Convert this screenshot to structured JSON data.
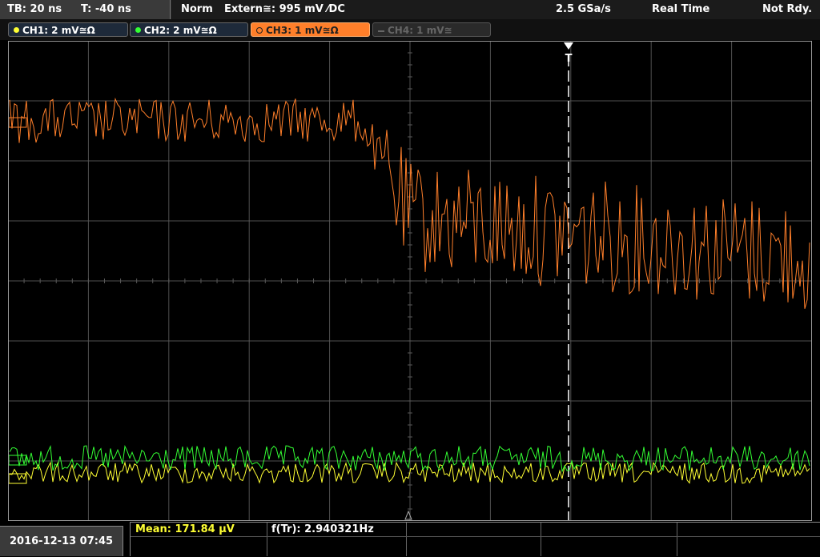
{
  "header": {
    "timebase": "TB: 20 ns",
    "trigger_time": "T: -40 ns",
    "mode": "Norm",
    "trigger_source": "Extern≅: 995 mV ⁄DC",
    "sample_rate": "2.5 GSa/s",
    "acquisition": "Real Time",
    "status": "Not Rdy."
  },
  "channels": [
    {
      "label": "CH1: 2 mV≅Ω",
      "color": "#ffff33",
      "state": "on"
    },
    {
      "label": "CH2: 2 mV≅Ω",
      "color": "#33ff33",
      "state": "on"
    },
    {
      "label": "CH3: 1 mV≅Ω",
      "color": "#ff7f2a",
      "state": "active"
    },
    {
      "label": "CH4: 1 mV≅",
      "color": "#777777",
      "state": "off"
    }
  ],
  "display": {
    "trigger_marker": "T",
    "colors": {
      "grid": "#5a5a5a",
      "trigger_line": "#ffffff",
      "ch1": "#ffff33",
      "ch2": "#33ff33",
      "ch3": "#ff7f2a"
    }
  },
  "footer": {
    "datetime": "2016-12-13 07:45",
    "mean_label": "Mean: 171.84 µV",
    "freq_label": "f(Tr): 2.940321Hz"
  }
}
